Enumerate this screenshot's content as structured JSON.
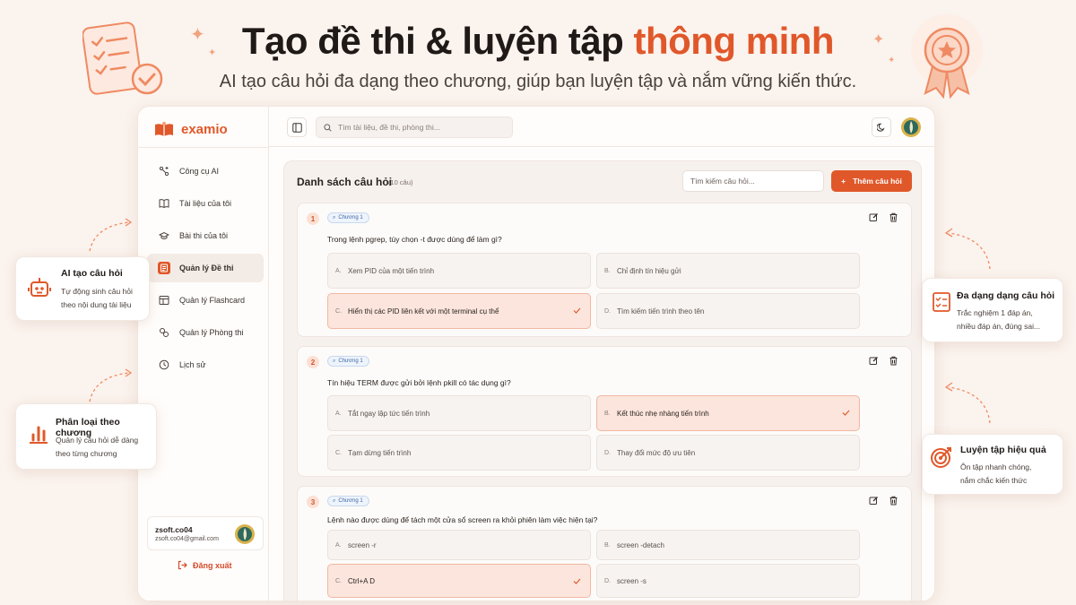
{
  "hero": {
    "title_main": "Tạo đề thi & luyện tập ",
    "title_accent": "thông minh",
    "subtitle": "AI tạo câu hỏi đa dạng theo chương, giúp bạn luyện tập và nắm vững kiến thức."
  },
  "app": {
    "logo": "examio",
    "search_placeholder": "Tìm tài liệu, đề thi, phòng thi...",
    "nav": [
      {
        "label": "Công cụ AI",
        "icon": "ai-tools-icon"
      },
      {
        "label": "Tài liệu của tôi",
        "icon": "book-icon"
      },
      {
        "label": "Bài thi của tôi",
        "icon": "graduation-cap-icon"
      },
      {
        "label": "Quản lý Đề thi",
        "icon": "exam-manage-icon",
        "active": true
      },
      {
        "label": "Quản lý Flashcard",
        "icon": "flashcard-icon"
      },
      {
        "label": "Quản lý Phòng thi",
        "icon": "room-icon"
      },
      {
        "label": "Lịch sử",
        "icon": "clock-icon"
      }
    ],
    "user": {
      "name": "zsoft.co04",
      "email": "zsoft.co04@gmail.com"
    },
    "logout": "Đăng xuất",
    "panel": {
      "title": "Danh sách câu hỏi",
      "count": "(10 câu)",
      "search_placeholder": "Tìm kiếm câu hỏi...",
      "add_label": "Thêm câu hỏi"
    },
    "questions": [
      {
        "num": "1",
        "chapter": "Chương 1",
        "text": "Trong lệnh pgrep, tùy chọn -t được dùng để làm gì?",
        "options": [
          {
            "letter": "A.",
            "text": "Xem PID của một tiến trình",
            "correct": false
          },
          {
            "letter": "B.",
            "text": "Chỉ định tín hiệu gửi",
            "correct": false
          },
          {
            "letter": "C.",
            "text": "Hiển thị các PID liên kết với một terminal cụ thể",
            "correct": true
          },
          {
            "letter": "D.",
            "text": "Tìm kiếm tiến trình theo tên",
            "correct": false
          }
        ]
      },
      {
        "num": "2",
        "chapter": "Chương 1",
        "text": "Tín hiệu TERM được gửi bởi lệnh pkill có tác dụng gì?",
        "options": [
          {
            "letter": "A.",
            "text": "Tắt ngay lập tức tiến trình",
            "correct": false
          },
          {
            "letter": "B.",
            "text": "Kết thúc nhẹ nhàng tiến trình",
            "correct": true
          },
          {
            "letter": "C.",
            "text": "Tạm dừng tiến trình",
            "correct": false
          },
          {
            "letter": "D.",
            "text": "Thay đổi mức độ ưu tiên",
            "correct": false
          }
        ]
      },
      {
        "num": "3",
        "chapter": "Chương 1",
        "text": "Lệnh nào được dùng để tách một cửa sổ screen ra khỏi phiên làm việc hiện tại?",
        "options": [
          {
            "letter": "A.",
            "text": "screen -r",
            "correct": false
          },
          {
            "letter": "B.",
            "text": "screen -detach",
            "correct": false
          },
          {
            "letter": "C.",
            "text": "Ctrl+A D",
            "correct": true
          },
          {
            "letter": "D.",
            "text": "screen -s",
            "correct": false
          }
        ]
      }
    ]
  },
  "features": {
    "ai": {
      "title": "AI tạo câu hỏi",
      "line1": "Tự động sinh câu hỏi",
      "line2": "theo nội dung tài liệu"
    },
    "classify": {
      "title": "Phân loại theo chương",
      "line1": "Quản lý câu hỏi dễ dàng",
      "line2": "theo từng chương"
    },
    "variety": {
      "title": "Đa dạng dạng câu hỏi",
      "line1": "Trắc nghiệm 1 đáp án,",
      "line2": "nhiều đáp án, đúng sai..."
    },
    "practice": {
      "title": "Luyện tập hiệu quả",
      "line1": "Ôn tập nhanh chóng,",
      "line2": "nắm chắc kiến thức"
    }
  },
  "colors": {
    "accent": "#e0582a",
    "background": "#fbf3ee"
  }
}
